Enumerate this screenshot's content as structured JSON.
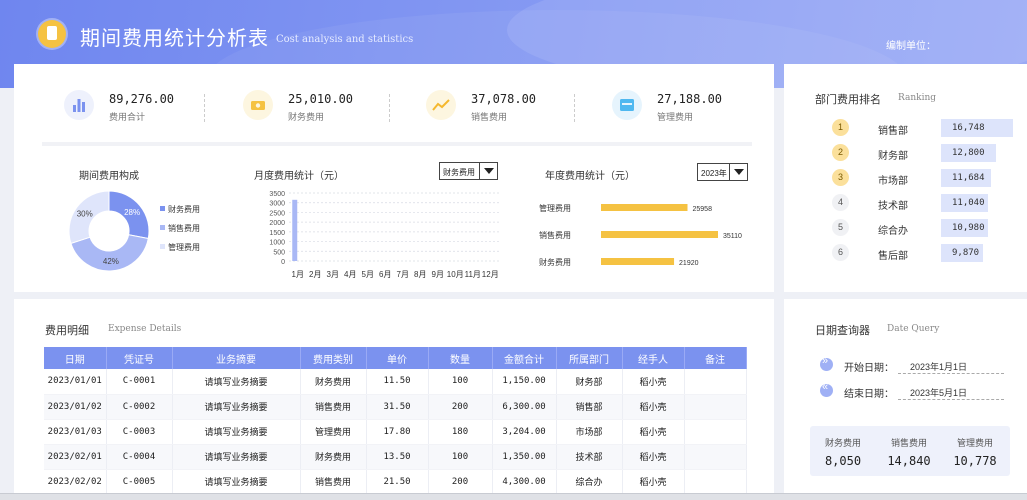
{
  "header": {
    "title": "期间费用统计分析表",
    "subtitle": "Cost analysis and statistics",
    "unit_label": "编制单位："
  },
  "kpis": [
    {
      "icon": "bar-chart-icon",
      "value": "89,276.00",
      "label": "费用合计",
      "color": "#7b92ef",
      "bg": "#eef1fc"
    },
    {
      "icon": "money-icon",
      "value": "25,010.00",
      "label": "财务费用",
      "color": "#f5c242",
      "bg": "#fdf6e0"
    },
    {
      "icon": "trend-icon",
      "value": "37,078.00",
      "label": "销售费用",
      "color": "#f5b82e",
      "bg": "#fdf6e0"
    },
    {
      "icon": "calendar-icon",
      "value": "27,188.00",
      "label": "管理费用",
      "color": "#4fb8f0",
      "bg": "#e6f4fd"
    }
  ],
  "charts": {
    "pie_title": "期间费用构成",
    "monthly_title": "月度费用统计（元）",
    "monthly_select": "财务费用",
    "annual_title": "年度费用统计（元）",
    "annual_select": "2023年"
  },
  "chart_data": [
    {
      "type": "pie",
      "title": "期间费用构成",
      "labels": [
        "财务费用",
        "销售费用",
        "管理费用"
      ],
      "values": [
        28,
        42,
        30
      ],
      "slice_labels": [
        "28%",
        "42%",
        "30%"
      ],
      "colors": [
        "#7b92ef",
        "#a9b8f5",
        "#dfe5fb"
      ],
      "legend": "right"
    },
    {
      "type": "bar",
      "title": "月度费用统计（元）",
      "categories": [
        "1月",
        "2月",
        "3月",
        "4月",
        "5月",
        "6月",
        "7月",
        "8月",
        "9月",
        "10月",
        "11月",
        "12月"
      ],
      "values": [
        3150,
        0,
        0,
        0,
        0,
        0,
        0,
        0,
        0,
        0,
        0,
        0
      ],
      "yticks": [
        "3500",
        "3000",
        "2500",
        "2000",
        "1500",
        "1000",
        "500",
        "0"
      ],
      "ylim": [
        0,
        3500
      ],
      "color": "#a9b8f5"
    },
    {
      "type": "bar",
      "orientation": "horizontal",
      "title": "年度费用统计（元）",
      "categories": [
        "管理费用",
        "销售费用",
        "财务费用"
      ],
      "values": [
        25958,
        35110,
        21920
      ],
      "value_labels": [
        "25958",
        "35110",
        "21920"
      ],
      "xlim": [
        0,
        35110
      ],
      "color": "#f5c242"
    }
  ],
  "ranking": {
    "title": "部门费用排名",
    "title_en": "Ranking",
    "max": 16748,
    "items": [
      {
        "rank": "1",
        "name": "销售部",
        "value": "16,748",
        "amount": 16748
      },
      {
        "rank": "2",
        "name": "财务部",
        "value": "12,800",
        "amount": 12800
      },
      {
        "rank": "3",
        "name": "市场部",
        "value": "11,684",
        "amount": 11684
      },
      {
        "rank": "4",
        "name": "技术部",
        "value": "11,040",
        "amount": 11040
      },
      {
        "rank": "5",
        "name": "综合办",
        "value": "10,980",
        "amount": 10980
      },
      {
        "rank": "6",
        "name": "售后部",
        "value": "9,870",
        "amount": 9870
      }
    ]
  },
  "details": {
    "title": "费用明细",
    "title_en": "Expense Details",
    "columns": [
      "日期",
      "凭证号",
      "业务摘要",
      "费用类别",
      "单价",
      "数量",
      "金额合计",
      "所属部门",
      "经手人",
      "备注"
    ],
    "rows": [
      [
        "2023/01/01",
        "C-0001",
        "请填写业务摘要",
        "财务费用",
        "11.50",
        "100",
        "1,150.00",
        "财务部",
        "稻小壳",
        ""
      ],
      [
        "2023/01/02",
        "C-0002",
        "请填写业务摘要",
        "销售费用",
        "31.50",
        "200",
        "6,300.00",
        "销售部",
        "稻小壳",
        ""
      ],
      [
        "2023/01/03",
        "C-0003",
        "请填写业务摘要",
        "管理费用",
        "17.80",
        "180",
        "3,204.00",
        "市场部",
        "稻小壳",
        ""
      ],
      [
        "2023/02/01",
        "C-0004",
        "请填写业务摘要",
        "财务费用",
        "13.50",
        "100",
        "1,350.00",
        "技术部",
        "稻小壳",
        ""
      ],
      [
        "2023/02/02",
        "C-0005",
        "请填写业务摘要",
        "销售费用",
        "21.50",
        "200",
        "4,300.00",
        "综合办",
        "稻小壳",
        ""
      ]
    ]
  },
  "query": {
    "title": "日期查询器",
    "title_en": "Date Query",
    "start_label": "开始日期：",
    "start_value": "2023年1月1日",
    "end_label": "结束日期：",
    "end_value": "2023年5月1日",
    "summary": [
      {
        "label": "财务费用",
        "value": "8,050"
      },
      {
        "label": "销售费用",
        "value": "14,840"
      },
      {
        "label": "管理费用",
        "value": "10,778"
      }
    ]
  }
}
